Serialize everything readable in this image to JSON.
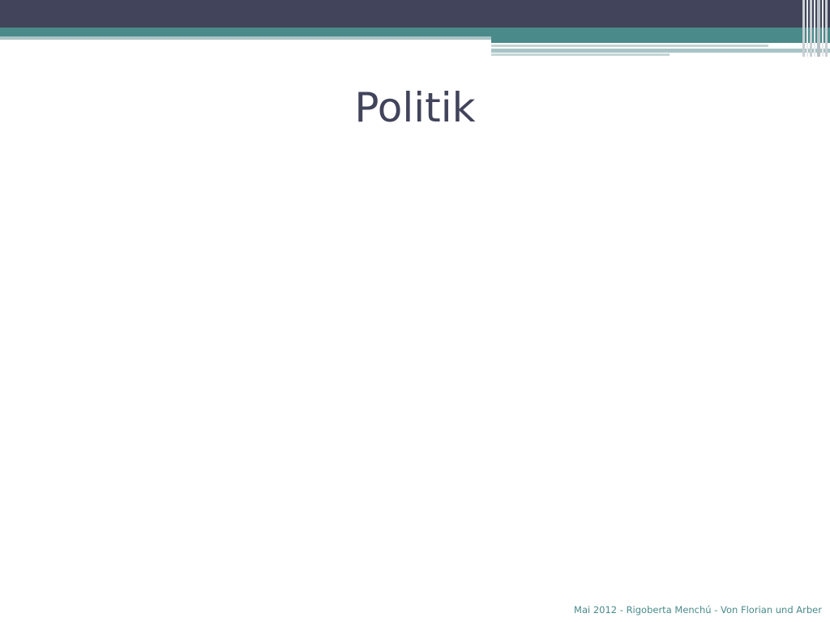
{
  "slide": {
    "title": "Politik",
    "footer": "Mai 2012 - Rigoberta Menchú - Von Florian und Arber"
  },
  "colors": {
    "header_dark": "#41445a",
    "accent_teal": "#4b8a8a",
    "accent_light": "#a9c4c6",
    "title_text": "#41445a",
    "footer_text": "#4b8a8a",
    "background": "#ffffff"
  }
}
